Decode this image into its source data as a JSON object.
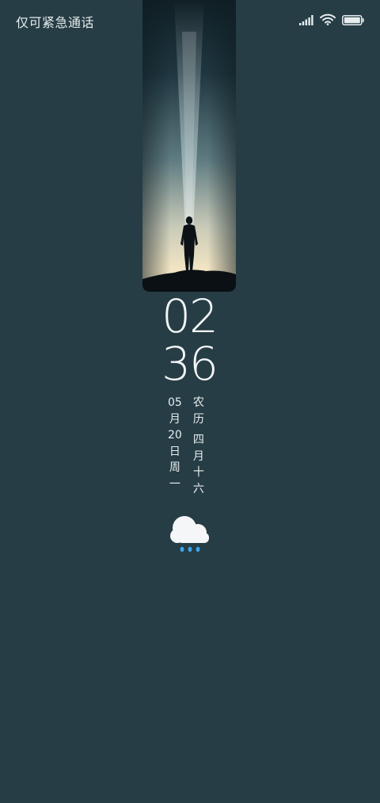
{
  "status_bar": {
    "carrier_text": "仅可紧急通话",
    "icons": [
      "signal-icon",
      "wifi-icon",
      "battery-icon"
    ]
  },
  "wallpaper": {
    "description_icon": "person-in-light-beam-wallpaper"
  },
  "clock": {
    "hours": "02",
    "minutes": "36"
  },
  "date": {
    "month_num": "05",
    "month_char": "月",
    "day_num": "20",
    "day_char": "日",
    "weekday_1": "周",
    "weekday_2": "一"
  },
  "lunar": {
    "label_1": "农",
    "label_2": "历",
    "month_1": "四",
    "month_2": "月",
    "day_1": "十",
    "day_2": "六"
  },
  "weather": {
    "icon": "rain-cloud-icon"
  },
  "colors": {
    "background": "#263d45",
    "text": "#e8eef0",
    "rain_drop": "#3aa6f0"
  }
}
